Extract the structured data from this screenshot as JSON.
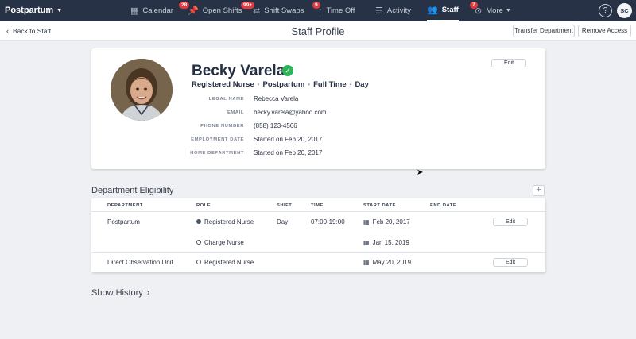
{
  "nav": {
    "brand": "Postpartum",
    "items": [
      {
        "label": "Calendar",
        "icon": "calendar-icon",
        "badge": ""
      },
      {
        "label": "Open Shifts",
        "icon": "pin-icon",
        "badge": "28"
      },
      {
        "label": "Shift Swaps",
        "icon": "swap-icon",
        "badge": "99+"
      },
      {
        "label": "Time Off",
        "icon": "palm-icon",
        "badge": "9"
      },
      {
        "label": "Activity",
        "icon": "list-icon",
        "badge": ""
      },
      {
        "label": "Staff",
        "icon": "staff-icon",
        "badge": ""
      },
      {
        "label": "More",
        "icon": "more-icon",
        "badge": "7"
      }
    ],
    "help": "?",
    "user_initials": "SC"
  },
  "subheader": {
    "back": "Back to Staff",
    "title": "Staff Profile",
    "transfer": "Transfer Department",
    "remove": "Remove Access"
  },
  "profile": {
    "name": "Becky Varela",
    "edit": "Edit",
    "tags": [
      "Registered Nurse",
      "Postpartum",
      "Full Time",
      "Day"
    ],
    "fields": [
      {
        "label": "LEGAL NAME",
        "value": "Rebecca Varela"
      },
      {
        "label": "EMAIL",
        "value": "becky.varela@yahoo.com"
      },
      {
        "label": "PHONE NUMBER",
        "value": "(858) 123-4566"
      },
      {
        "label": "EMPLOYMENT DATE",
        "value": "Started on Feb 20, 2017"
      },
      {
        "label": "HOME DEPARTMENT",
        "value": "Started on Feb 20, 2017"
      }
    ]
  },
  "eligibility": {
    "title": "Department Eligibility",
    "add": "+",
    "headers": [
      "DEPARTMENT",
      "ROLE",
      "SHIFT",
      "TIME",
      "START DATE",
      "END DATE"
    ],
    "rows": [
      {
        "department": "Postpartum",
        "role": "Registered Nurse",
        "role_primary": true,
        "shift": "Day",
        "time": "07:00-19:00",
        "start": "Feb 20, 2017",
        "end": "",
        "edit": "Edit"
      },
      {
        "department": "",
        "role": "Charge Nurse",
        "role_primary": false,
        "shift": "",
        "time": "",
        "start": "Jan 15, 2019",
        "end": "",
        "edit": ""
      },
      {
        "department": "Direct Observation Unit",
        "role": "Registered Nurse",
        "role_primary": false,
        "shift": "",
        "time": "",
        "start": "May 20, 2019",
        "end": "",
        "edit": "Edit"
      }
    ]
  },
  "history": "Show History"
}
